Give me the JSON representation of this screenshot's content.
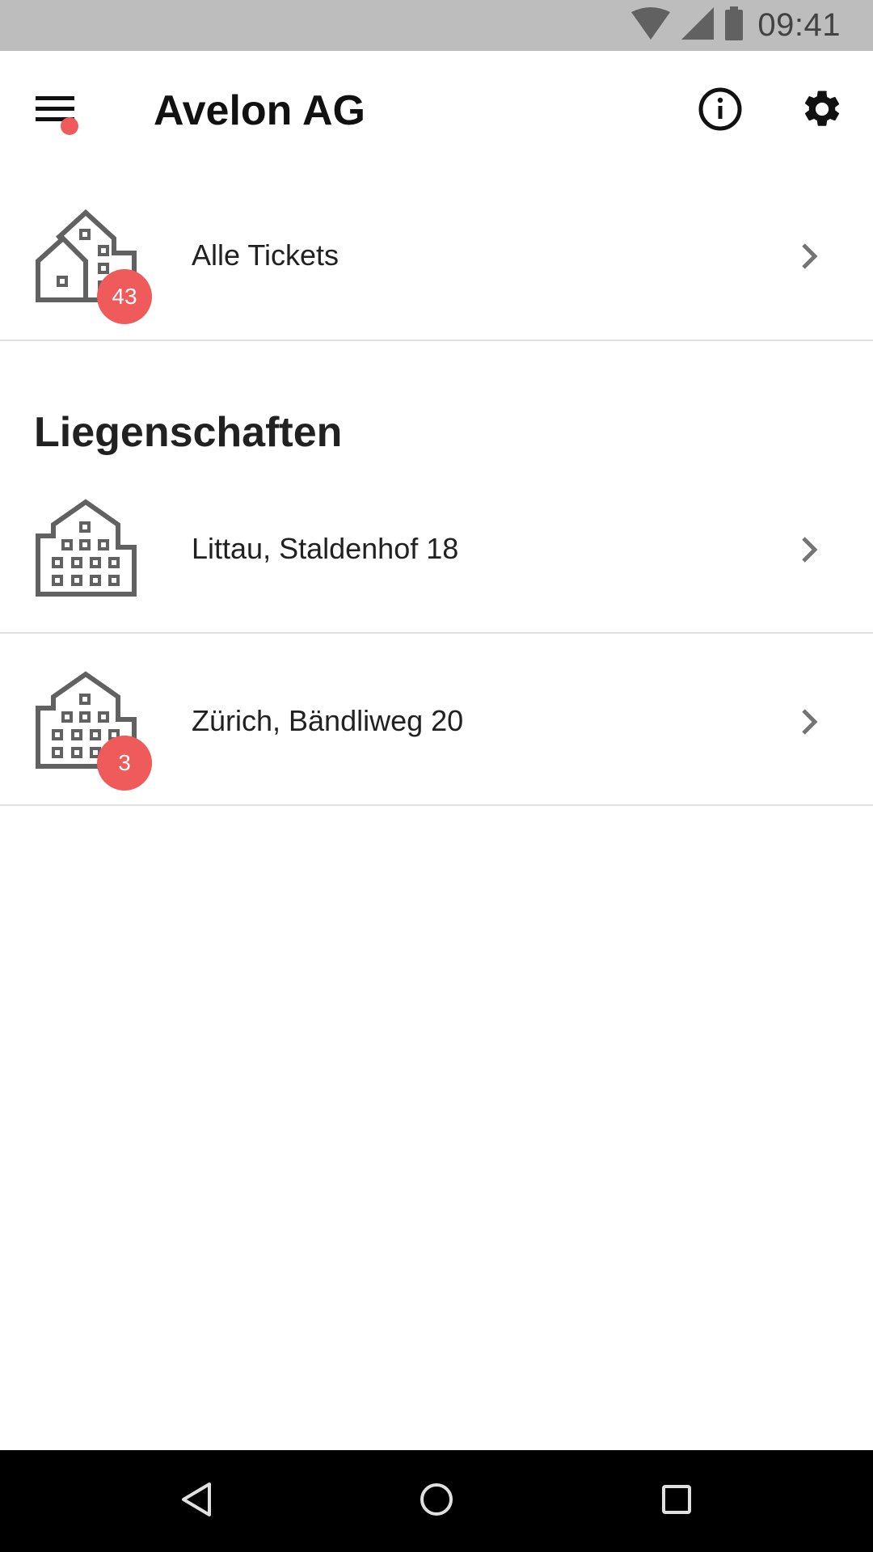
{
  "status_bar": {
    "time": "09:41",
    "icons": [
      "wifi-icon",
      "signal-icon",
      "battery-icon"
    ]
  },
  "app_bar": {
    "title": "Avelon AG",
    "menu_icon": "menu-icon",
    "has_notification_dot": true,
    "actions": [
      "info-icon",
      "gear-icon"
    ]
  },
  "all_tickets": {
    "label": "Alle Tickets",
    "badge": "43",
    "icon": "buildings-icon"
  },
  "section": {
    "title": "Liegenschaften"
  },
  "properties": [
    {
      "label": "Littau, Staldenhof 18",
      "badge": "",
      "icon": "building-icon"
    },
    {
      "label": "Zürich, Bändliweg 20",
      "badge": "3",
      "icon": "building-icon"
    }
  ],
  "colors": {
    "accent": "#ef5a5a",
    "icon_gray": "#616161",
    "status_bar": "#bdbdbd",
    "nav_bar": "#000000"
  }
}
